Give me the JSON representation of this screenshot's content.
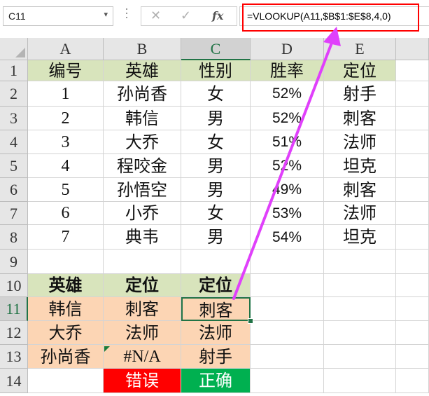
{
  "formula_bar": {
    "name_box": "C11",
    "name_box_dropdown_icon": "chevron-down-icon",
    "cancel_icon": "close-icon",
    "enter_icon": "check-icon",
    "function_icon": "fx",
    "formula": "=VLOOKUP(A11,$B$1:$E$8,4,0)"
  },
  "columns": [
    "A",
    "B",
    "C",
    "D",
    "E"
  ],
  "selected_column": "C",
  "rows": [
    "1",
    "2",
    "3",
    "4",
    "5",
    "6",
    "7",
    "8",
    "9",
    "10",
    "11",
    "12",
    "13",
    "14"
  ],
  "selected_row": "11",
  "table": {
    "header": [
      "编号",
      "英雄",
      "性别",
      "胜率",
      "定位"
    ],
    "body": [
      [
        "1",
        "孙尚香",
        "女",
        "52%",
        "射手"
      ],
      [
        "2",
        "韩信",
        "男",
        "52%",
        "刺客"
      ],
      [
        "3",
        "大乔",
        "女",
        "51%",
        "法师"
      ],
      [
        "4",
        "程咬金",
        "男",
        "52%",
        "坦克"
      ],
      [
        "5",
        "孙悟空",
        "男",
        "49%",
        "刺客"
      ],
      [
        "6",
        "小乔",
        "女",
        "53%",
        "法师"
      ],
      [
        "7",
        "典韦",
        "男",
        "54%",
        "坦克"
      ]
    ]
  },
  "lookup": {
    "header": [
      "英雄",
      "定位",
      "定位"
    ],
    "body": [
      [
        "韩信",
        "刺客",
        "刺客"
      ],
      [
        "大乔",
        "法师",
        "法师"
      ],
      [
        "孙尚香",
        "#N/A",
        "射手"
      ]
    ],
    "wrong_label": "错误",
    "right_label": "正确"
  },
  "colors": {
    "header_fill": "#d8e4bc",
    "lookup_fill": "#fcd5b4",
    "wrong_fill": "#ff0000",
    "right_fill": "#00b050",
    "formula_highlight": "#ff0000",
    "arrow": "#e040fb",
    "selection": "#217346"
  }
}
